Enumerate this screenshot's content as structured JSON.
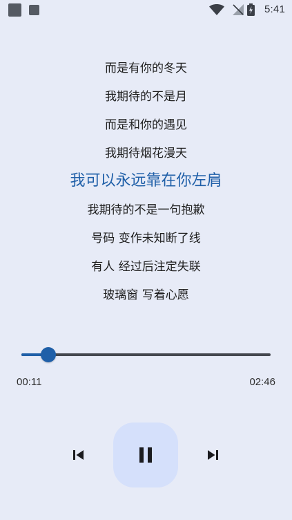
{
  "status_bar": {
    "time": "5:41",
    "icons": [
      "notification-square-icon",
      "notification-square-icon",
      "wifi-icon",
      "no-signal-icon",
      "battery-charging-icon"
    ]
  },
  "lyrics": {
    "lines": [
      "而是有你的冬天",
      "我期待的不是月",
      "而是和你的遇见",
      "我期待烟花漫天",
      "我可以永远靠在你左肩",
      "我期待的不是一句抱歉",
      "号码 变作未知断了线",
      "有人 经过后注定失联",
      "玻璃窗 写着心愿"
    ],
    "current_index": 4
  },
  "player": {
    "elapsed": "00:11",
    "total": "02:46",
    "progress_fraction": 0.066,
    "state": "playing",
    "controls": [
      "skip-previous-icon",
      "pause-icon",
      "skip-next-icon"
    ]
  },
  "colors": {
    "background": "#e7ebf7",
    "accent": "#1f5fa8",
    "track": "#44474e",
    "play_button_bg": "#d5e0fb",
    "text": "#1f1f1f"
  }
}
